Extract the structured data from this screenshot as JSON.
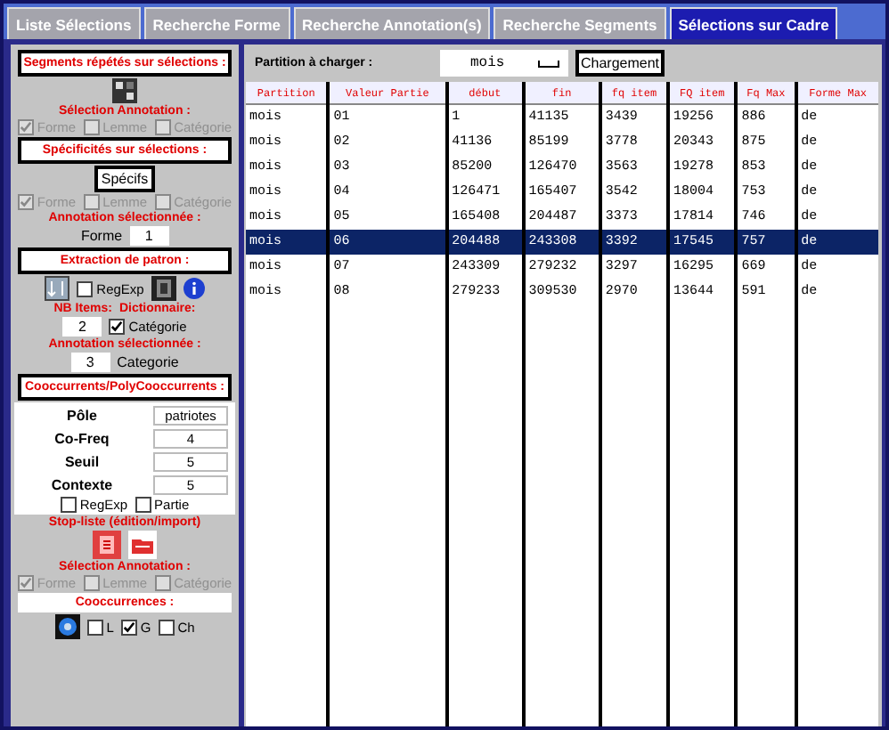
{
  "tabs": [
    {
      "label": "Liste Sélections",
      "selected": false
    },
    {
      "label": "Recherche Forme",
      "selected": false
    },
    {
      "label": "Recherche Annotation(s)",
      "selected": false
    },
    {
      "label": "Recherche Segments",
      "selected": false
    },
    {
      "label": "Sélections sur Cadre",
      "selected": true
    }
  ],
  "left_panel": [
    {
      "kind": "boxed_heading",
      "text": "Segments répétés sur sélections :"
    },
    {
      "kind": "parts",
      "parts": [
        {
          "kind": "grid_icon"
        }
      ]
    },
    {
      "kind": "label",
      "text": "Sélection Annotation :"
    },
    {
      "kind": "parts",
      "parts": [
        {
          "kind": "check",
          "label": "Forme",
          "checked": true,
          "disabled": true
        },
        {
          "kind": "check",
          "label": "Lemme",
          "checked": false,
          "disabled": true
        },
        {
          "kind": "check",
          "label": "Catégorie",
          "checked": false,
          "disabled": true
        }
      ]
    },
    {
      "kind": "boxed_heading",
      "text": "Spécificités sur sélections :"
    },
    {
      "kind": "parts",
      "parts": [
        {
          "kind": "button",
          "text": "Spécifs"
        }
      ]
    },
    {
      "kind": "parts",
      "parts": [
        {
          "kind": "check",
          "label": "Forme",
          "checked": true,
          "disabled": true
        },
        {
          "kind": "check",
          "label": "Lemme",
          "checked": false,
          "disabled": true
        },
        {
          "kind": "check",
          "label": "Catégorie",
          "checked": false,
          "disabled": true
        }
      ]
    },
    {
      "kind": "label",
      "text": "Annotation sélectionnée :"
    },
    {
      "kind": "parts",
      "parts": [
        {
          "kind": "text",
          "text": "Forme"
        },
        {
          "kind": "field",
          "value": "1"
        }
      ]
    },
    {
      "kind": "boxed_heading",
      "text": "Extraction de patron :"
    },
    {
      "kind": "parts",
      "parts": [
        {
          "kind": "sort_icon"
        },
        {
          "kind": "check",
          "label": "RegExp",
          "checked": false,
          "disabled": false
        },
        {
          "kind": "book_icon"
        },
        {
          "kind": "info_icon"
        }
      ]
    },
    {
      "kind": "parts",
      "parts": [
        {
          "kind": "red_text",
          "text": "NB Items:"
        },
        {
          "kind": "red_text",
          "text": "Dictionnaire:"
        }
      ]
    },
    {
      "kind": "parts",
      "parts": [
        {
          "kind": "field",
          "value": "2"
        },
        {
          "kind": "check",
          "label": "Catégorie",
          "checked": true,
          "disabled": false
        }
      ]
    },
    {
      "kind": "label",
      "text": "Annotation sélectionnée :"
    },
    {
      "kind": "parts",
      "parts": [
        {
          "kind": "field",
          "value": "3"
        },
        {
          "kind": "text",
          "text": "Categorie"
        }
      ]
    },
    {
      "kind": "boxed_heading",
      "text": "Cooccurrents/PolyCooccurrents :"
    },
    {
      "kind": "form",
      "rows": [
        {
          "label": "Pôle",
          "value": "patriotes"
        },
        {
          "label": "Co-Freq",
          "value": "4"
        },
        {
          "label": "Seuil",
          "value": "5"
        },
        {
          "label": "Contexte",
          "value": "5"
        }
      ],
      "checks": [
        {
          "label": "RegExp",
          "checked": false
        },
        {
          "label": "Partie",
          "checked": false
        }
      ]
    },
    {
      "kind": "label",
      "text": "Stop-liste (édition/import)"
    },
    {
      "kind": "parts",
      "parts": [
        {
          "kind": "doc_icon"
        },
        {
          "kind": "folder_icon"
        }
      ]
    },
    {
      "kind": "label",
      "text": "Sélection Annotation :"
    },
    {
      "kind": "parts",
      "parts": [
        {
          "kind": "check",
          "label": "Forme",
          "checked": true,
          "disabled": true
        },
        {
          "kind": "check",
          "label": "Lemme",
          "checked": false,
          "disabled": true
        },
        {
          "kind": "check",
          "label": "Catégorie",
          "checked": false,
          "disabled": true
        }
      ]
    },
    {
      "kind": "plain_heading",
      "text": "Cooccurrences :"
    },
    {
      "kind": "parts",
      "parts": [
        {
          "kind": "disc_icon"
        },
        {
          "kind": "check",
          "label": "L",
          "checked": false,
          "disabled": false
        },
        {
          "kind": "check",
          "label": "G",
          "checked": true,
          "disabled": false
        },
        {
          "kind": "check",
          "label": "Ch",
          "checked": false,
          "disabled": false
        }
      ]
    }
  ],
  "toolbar": {
    "label": "Partition à charger :",
    "dropdown": "mois",
    "button": "Chargement"
  },
  "table": {
    "columns": [
      "Partition",
      "Valeur Partie",
      "début",
      "fin",
      "fq item",
      "FQ item",
      "Fq Max",
      "Forme Max"
    ],
    "rows": [
      {
        "cells": [
          "mois",
          "01",
          "1",
          "41135",
          "3439",
          "19256",
          "886",
          "de"
        ],
        "selected": false
      },
      {
        "cells": [
          "mois",
          "02",
          "41136",
          "85199",
          "3778",
          "20343",
          "875",
          "de"
        ],
        "selected": false
      },
      {
        "cells": [
          "mois",
          "03",
          "85200",
          "126470",
          "3563",
          "19278",
          "853",
          "de"
        ],
        "selected": false
      },
      {
        "cells": [
          "mois",
          "04",
          "126471",
          "165407",
          "3542",
          "18004",
          "753",
          "de"
        ],
        "selected": false
      },
      {
        "cells": [
          "mois",
          "05",
          "165408",
          "204487",
          "3373",
          "17814",
          "746",
          "de"
        ],
        "selected": false
      },
      {
        "cells": [
          "mois",
          "06",
          "204488",
          "243308",
          "3392",
          "17545",
          "757",
          "de"
        ],
        "selected": true
      },
      {
        "cells": [
          "mois",
          "07",
          "243309",
          "279232",
          "3297",
          "16295",
          "669",
          "de"
        ],
        "selected": false
      },
      {
        "cells": [
          "mois",
          "08",
          "279233",
          "309530",
          "2970",
          "13644",
          "591",
          "de"
        ],
        "selected": false
      }
    ]
  }
}
